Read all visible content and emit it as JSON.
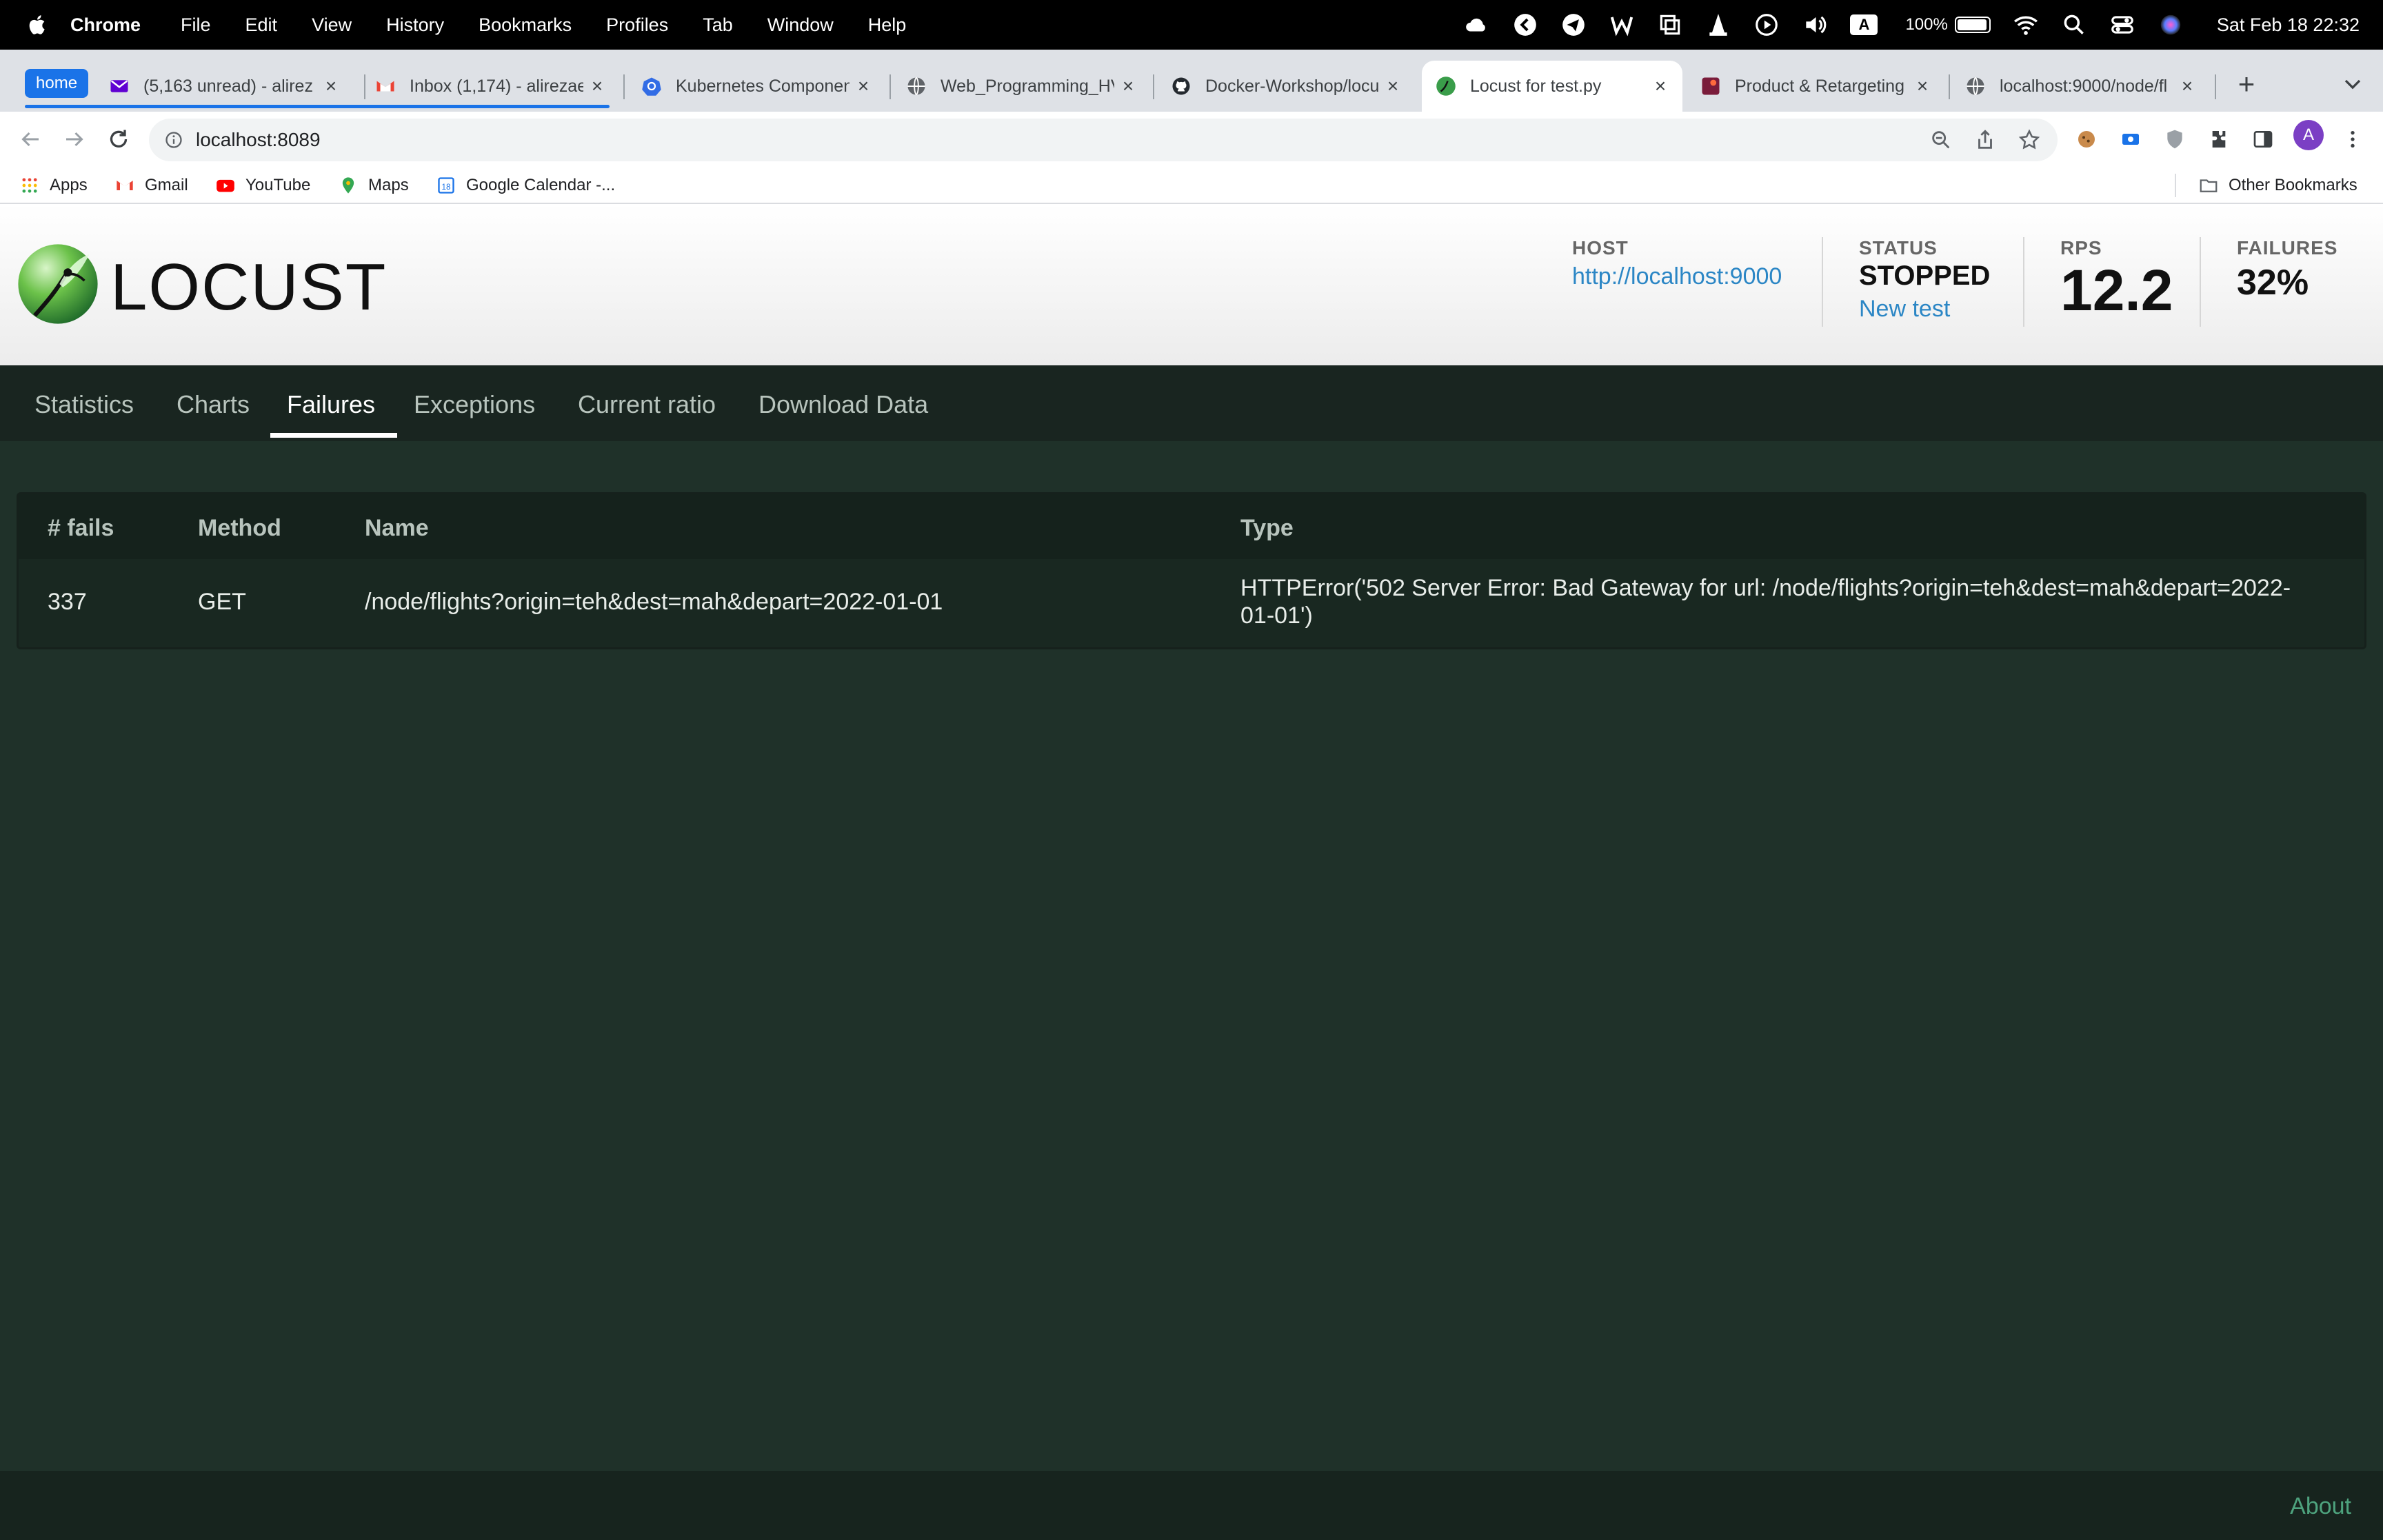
{
  "menubar": {
    "app": "Chrome",
    "items": [
      "File",
      "Edit",
      "View",
      "History",
      "Bookmarks",
      "Profiles",
      "Tab",
      "Window",
      "Help"
    ],
    "battery": "100%",
    "clock": "Sat Feb 18  22:32",
    "input_source": "A"
  },
  "tabs": {
    "group_label": "home",
    "items": [
      {
        "label": "(5,163 unread) - alirez",
        "icon": "yahoo-mail-icon"
      },
      {
        "label": "Inbox (1,174) - alirezae",
        "icon": "gmail-icon"
      },
      {
        "label": "Kubernetes Componen",
        "icon": "kubernetes-icon"
      },
      {
        "label": "Web_Programming_HV",
        "icon": "globe-icon"
      },
      {
        "label": "Docker-Workshop/locu",
        "icon": "github-icon"
      },
      {
        "label": "Locust for test.py",
        "icon": "locust-icon"
      },
      {
        "label": "Product & Retargeting",
        "icon": "product-icon"
      },
      {
        "label": "localhost:9000/node/fl",
        "icon": "globe-icon"
      }
    ]
  },
  "toolbar": {
    "url": "localhost:8089",
    "profile_initial": "A"
  },
  "bookmarks": {
    "items": [
      "Apps",
      "Gmail",
      "YouTube",
      "Maps",
      "Google Calendar -..."
    ],
    "other": "Other Bookmarks"
  },
  "locust": {
    "logo_text": "LOCUST",
    "host_label": "HOST",
    "host_value": "http://localhost:9000",
    "status_label": "STATUS",
    "status_value": "STOPPED",
    "new_test": "New test",
    "rps_label": "RPS",
    "rps_value": "12.2",
    "failures_label": "FAILURES",
    "failures_value": "32%"
  },
  "nav": {
    "tabs": [
      "Statistics",
      "Charts",
      "Failures",
      "Exceptions",
      "Current ratio",
      "Download Data"
    ],
    "active": "Failures"
  },
  "failures_table": {
    "headers": [
      "# fails",
      "Method",
      "Name",
      "Type"
    ],
    "rows": [
      {
        "fails": "337",
        "method": "GET",
        "name": "/node/flights?origin=teh&dest=mah&depart=2022-01-01",
        "type_line1": "HTTPError('502 Server Error: Bad Gateway for url: /node/flights?origin=teh&dest=mah&depart=2022-",
        "type_line2": "01-01')"
      }
    ]
  },
  "footer": {
    "about": "About"
  }
}
